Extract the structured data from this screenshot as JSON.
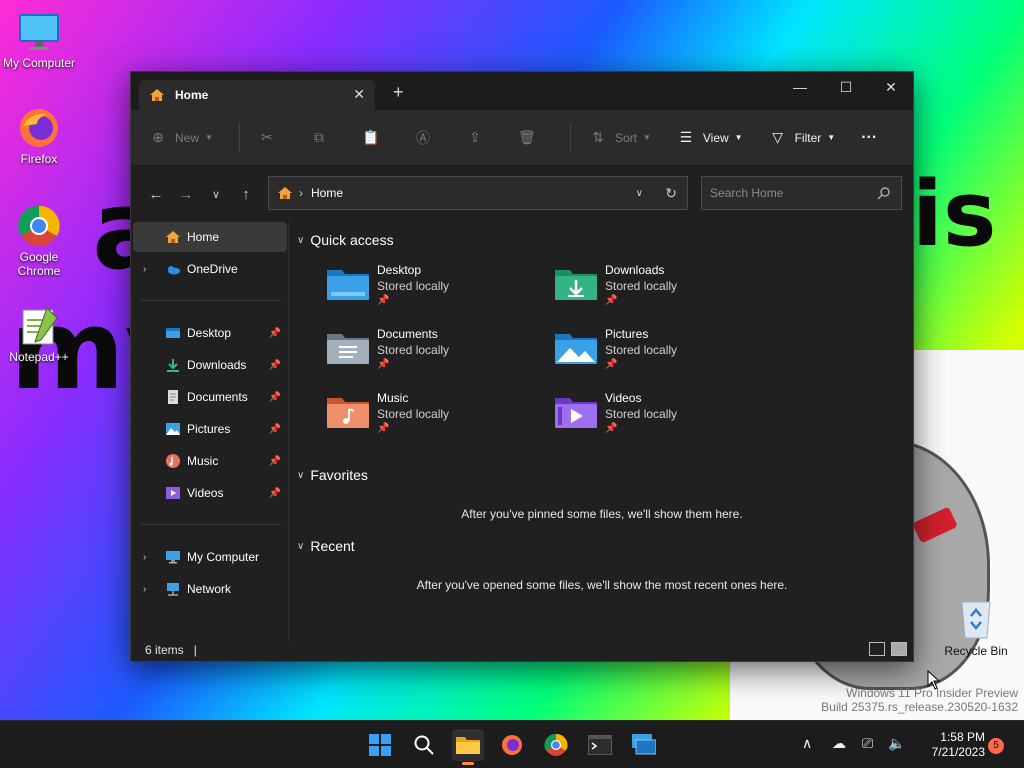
{
  "desktop": {
    "icons": [
      {
        "label": "My Computer",
        "icon": "monitor-icon"
      },
      {
        "label": "Firefox",
        "icon": "firefox-icon"
      },
      {
        "label": "Google Chrome",
        "icon": "chrome-icon"
      },
      {
        "label": "Notepad++",
        "icon": "notepadpp-icon"
      }
    ],
    "recycle_bin": "Recycle Bin",
    "watermark": {
      "line1": "Windows 11 Pro Insider Preview",
      "line2": "Build 25375.rs_release.230520-1632"
    }
  },
  "window": {
    "tab_title": "Home",
    "tab_close": "✕",
    "new_tab": "+",
    "controls": {
      "minimize": "—",
      "maximize": "☐",
      "close": "✕"
    },
    "commands": {
      "new": "New",
      "sort": "Sort",
      "view": "View",
      "filter": "Filter",
      "more": "···"
    },
    "address": {
      "path": "Home",
      "separator": "›"
    },
    "search_placeholder": "Search Home",
    "sidebar": {
      "home": "Home",
      "onedrive": "OneDrive",
      "pinned": [
        {
          "label": "Desktop"
        },
        {
          "label": "Downloads"
        },
        {
          "label": "Documents"
        },
        {
          "label": "Pictures"
        },
        {
          "label": "Music"
        },
        {
          "label": "Videos"
        }
      ],
      "my_computer": "My Computer",
      "network": "Network"
    },
    "content": {
      "quick_access": "Quick access",
      "items": [
        {
          "name": "Desktop",
          "sub": "Stored locally"
        },
        {
          "name": "Downloads",
          "sub": "Stored locally"
        },
        {
          "name": "Documents",
          "sub": "Stored locally"
        },
        {
          "name": "Pictures",
          "sub": "Stored locally"
        },
        {
          "name": "Music",
          "sub": "Stored locally"
        },
        {
          "name": "Videos",
          "sub": "Stored locally"
        }
      ],
      "favorites": "Favorites",
      "favorites_empty": "After you've pinned some files, we'll show them here.",
      "recent": "Recent",
      "recent_empty": "After you've opened some files, we'll show the most recent ones here."
    },
    "status": {
      "count": "6 items",
      "cursor": "|"
    }
  },
  "taskbar": {
    "clock_time": "1:58 PM",
    "clock_date": "7/21/2023",
    "notification_count": "5"
  },
  "colors": {
    "window_bg": "#202020",
    "command_bar": "#2b2b2b",
    "accent_folder": "#3aa0e8",
    "selection": "#3a3a3a"
  }
}
